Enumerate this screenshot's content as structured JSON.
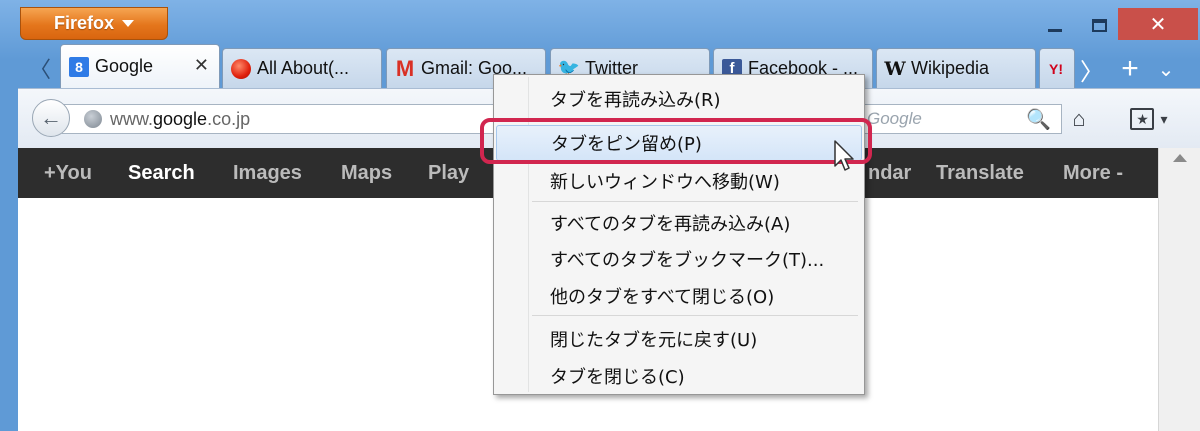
{
  "app": {
    "button_label": "Firefox",
    "window_controls": {
      "minimize": "minimize-icon",
      "maximize": "maximize-icon",
      "close": "✕"
    }
  },
  "tabs": [
    {
      "label": "Google",
      "favicon": "google-favicon",
      "favicon_text": "8",
      "active": true,
      "close": "✕"
    },
    {
      "label": "All About(...",
      "favicon": "allabout-favicon",
      "favicon_text": ""
    },
    {
      "label": "Gmail: Goo...",
      "favicon": "gmail-favicon",
      "favicon_text": "M"
    },
    {
      "label": "Twitter",
      "favicon": "twitter-favicon",
      "favicon_text": "🐦"
    },
    {
      "label": "Facebook - ...",
      "favicon": "facebook-favicon",
      "favicon_text": "f"
    },
    {
      "label": "Wikipedia",
      "favicon": "wikipedia-favicon",
      "favicon_text": "W"
    },
    {
      "label": "",
      "favicon": "yahoo-favicon",
      "favicon_text": "Y!"
    }
  ],
  "tab_controls": {
    "scroll_left": "〈",
    "scroll_right": "〉",
    "new_tab": "+",
    "list_all": "⌄"
  },
  "navbar": {
    "back": "←",
    "url_prefix": "www.",
    "url_domain": "google",
    "url_suffix": ".co.jp",
    "search_placeholder": "Google",
    "search_icon": "🔍",
    "home_icon": "⌂",
    "bookmark_icon": "★",
    "bookmark_menu": "▾"
  },
  "google_bar": {
    "items": [
      "+You",
      "Search",
      "Images",
      "Maps",
      "Play",
      "ndar",
      "Translate",
      "More -"
    ],
    "active": "Search"
  },
  "context_menu": {
    "items": [
      "タブを再読み込み(R)",
      "タブをピン留め(P)",
      "新しいウィンドウへ移動(W)",
      "すべてのタブを再読み込み(A)",
      "すべてのタブをブックマーク(T)...",
      "他のタブをすべて閉じる(O)",
      "閉じたタブを元に戻す(U)",
      "タブを閉じる(C)"
    ],
    "highlighted_index": 1,
    "highlight_color": "#d1264f"
  }
}
